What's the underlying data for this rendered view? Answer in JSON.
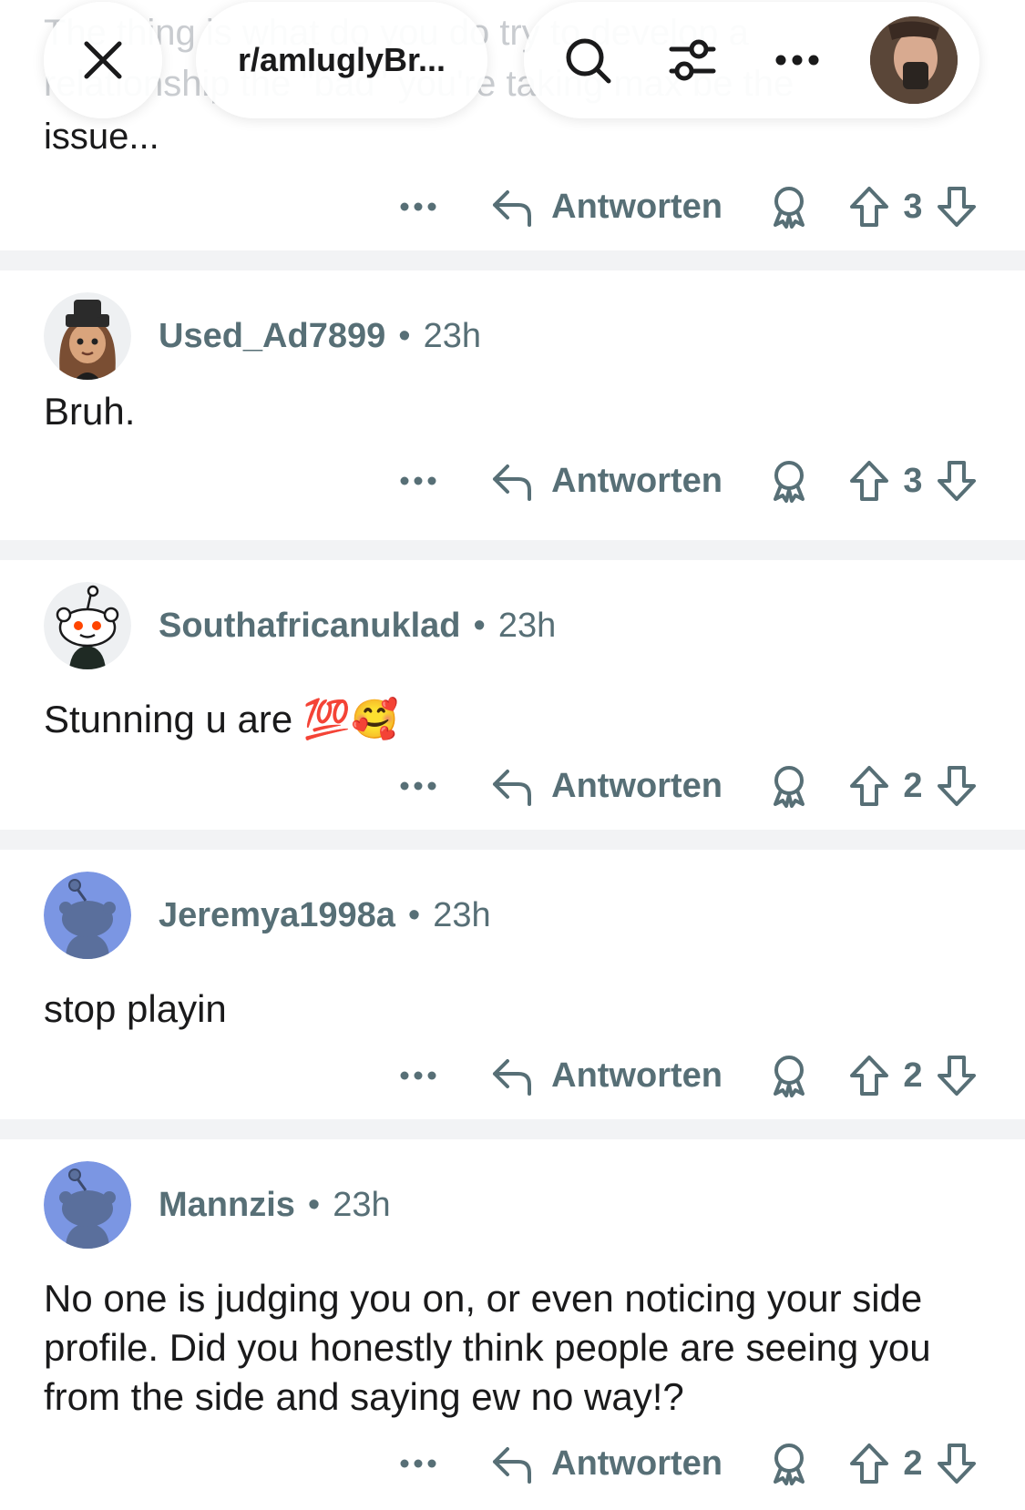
{
  "header": {
    "subreddit": "r/amIuglyBr...",
    "ghost_line_1": "The thing is what do you do try to develop a",
    "ghost_line_2": "relationship the \"bad\" you're taking max be the",
    "previous_excerpt": "issue..."
  },
  "icons": {
    "close": "close-icon",
    "search": "search-icon",
    "filter": "filter-icon",
    "more": "more-icon",
    "reply": "reply-icon",
    "award": "award-icon",
    "upvote": "upvote-icon",
    "downvote": "downvote-icon"
  },
  "colors": {
    "meta_text": "#576f76",
    "divider": "#f2f3f5",
    "snoo_bg": "#7b96e3"
  },
  "actions": {
    "reply_label": "Antworten"
  },
  "previous_comment": {
    "score": "3"
  },
  "comments": [
    {
      "user": "Used_Ad7899",
      "time": "23h",
      "text": "Bruh.",
      "score": "3"
    },
    {
      "user": "Southafricanuklad",
      "time": "23h",
      "text": "Stunning u are 💯🥰",
      "score": "2"
    },
    {
      "user": "Jeremya1998a",
      "time": "23h",
      "text": "stop playin",
      "score": "2"
    },
    {
      "user": "Mannzis",
      "time": "23h",
      "text": "No one is judging you on, or even noticing your side profile. Did you honestly think people are seeing you from the side and saying ew no way!?",
      "score": "2"
    }
  ]
}
